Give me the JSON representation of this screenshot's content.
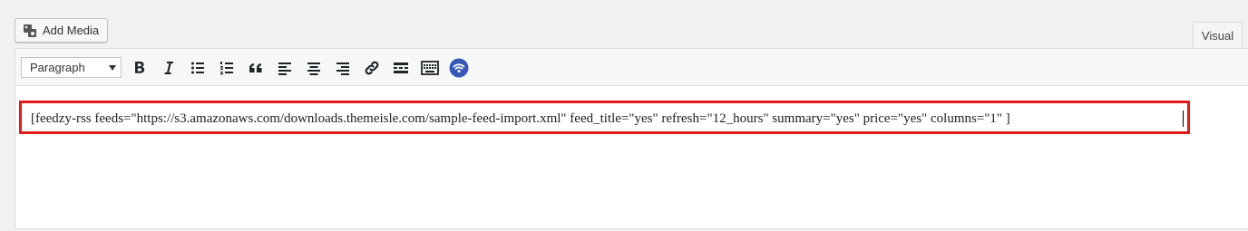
{
  "toolbar_top": {
    "add_media_label": "Add Media",
    "add_media_icon": "media-icon"
  },
  "tabs": {
    "visual_label": "Visual"
  },
  "editor": {
    "format_select_value": "Paragraph",
    "buttons": [
      {
        "name": "bold-icon"
      },
      {
        "name": "italic-icon"
      },
      {
        "name": "bulleted-list-icon"
      },
      {
        "name": "numbered-list-icon"
      },
      {
        "name": "blockquote-icon"
      },
      {
        "name": "align-left-icon"
      },
      {
        "name": "align-center-icon"
      },
      {
        "name": "align-right-icon"
      },
      {
        "name": "link-icon"
      },
      {
        "name": "read-more-icon"
      },
      {
        "name": "toolbar-toggle-icon"
      },
      {
        "name": "feedzy-icon"
      }
    ],
    "content_text": "[feedzy-rss feeds=\"https://s3.amazonaws.com/downloads.themeisle.com/sample-feed-import.xml\" feed_title=\"yes\" refresh=\"12_hours\" summary=\"yes\" price=\"yes\" columns=\"1\" ]",
    "highlight_color": "#e11b1b",
    "feedzy_color": "#3858b8"
  }
}
